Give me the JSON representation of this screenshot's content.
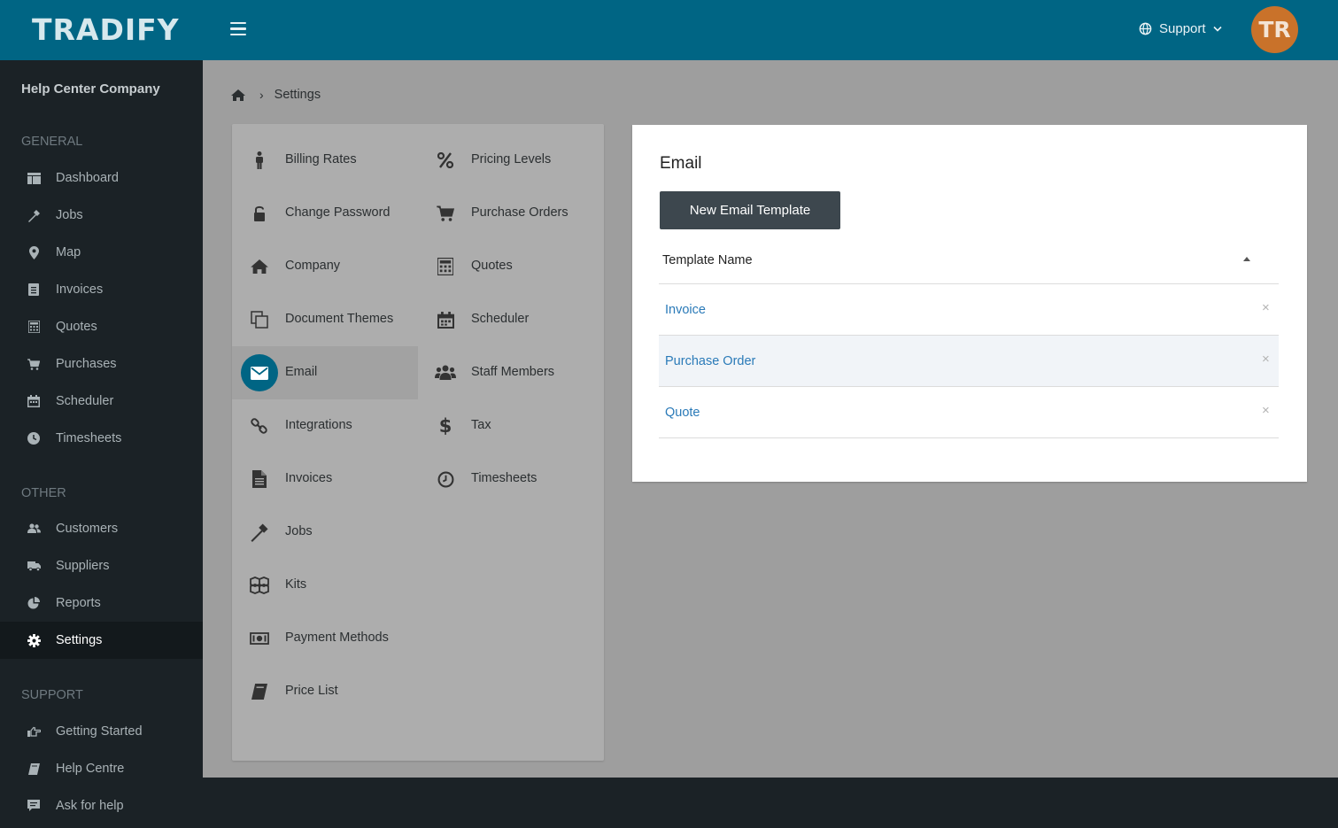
{
  "app": {
    "logo": "TRADIFY"
  },
  "header": {
    "support_label": "Support",
    "support_icon": "globe-icon",
    "avatar_initials": "TR",
    "accent": "#006584",
    "avatar_color": "#c9722a"
  },
  "sidebar": {
    "company": "Help Center Company",
    "sections": {
      "general": "GENERAL",
      "other": "OTHER",
      "support": "SUPPORT"
    },
    "general": [
      {
        "label": "Dashboard",
        "icon": "dashboard-icon"
      },
      {
        "label": "Jobs",
        "icon": "hammer-icon"
      },
      {
        "label": "Map",
        "icon": "map-pin-icon"
      },
      {
        "label": "Invoices",
        "icon": "invoice-icon"
      },
      {
        "label": "Quotes",
        "icon": "calculator-icon"
      },
      {
        "label": "Purchases",
        "icon": "cart-icon"
      },
      {
        "label": "Scheduler",
        "icon": "calendar-icon"
      },
      {
        "label": "Timesheets",
        "icon": "clock-icon"
      }
    ],
    "other": [
      {
        "label": "Customers",
        "icon": "users-icon"
      },
      {
        "label": "Suppliers",
        "icon": "truck-icon"
      },
      {
        "label": "Reports",
        "icon": "pie-chart-icon"
      },
      {
        "label": "Settings",
        "icon": "gear-icon",
        "active": true
      }
    ],
    "support": [
      {
        "label": "Getting Started",
        "icon": "hand-point-icon"
      },
      {
        "label": "Help Centre",
        "icon": "book-icon"
      },
      {
        "label": "Ask for help",
        "icon": "chat-icon"
      }
    ]
  },
  "breadcrumb": {
    "home_icon": "home-icon",
    "current": "Settings"
  },
  "settings_menu": {
    "left": [
      {
        "label": "Billing Rates",
        "icon": "person-icon"
      },
      {
        "label": "Change Password",
        "icon": "unlock-icon"
      },
      {
        "label": "Company",
        "icon": "home-icon"
      },
      {
        "label": "Document Themes",
        "icon": "copy-icon"
      },
      {
        "label": "Email",
        "icon": "envelope-icon",
        "active": true
      },
      {
        "label": "Integrations",
        "icon": "link-icon"
      },
      {
        "label": "Invoices",
        "icon": "file-icon"
      },
      {
        "label": "Jobs",
        "icon": "hammer-icon"
      },
      {
        "label": "Kits",
        "icon": "cubes-icon"
      },
      {
        "label": "Payment Methods",
        "icon": "money-icon"
      },
      {
        "label": "Price List",
        "icon": "book-icon"
      }
    ],
    "right": [
      {
        "label": "Pricing Levels",
        "icon": "percent-icon"
      },
      {
        "label": "Purchase Orders",
        "icon": "cart-icon"
      },
      {
        "label": "Quotes",
        "icon": "calculator-icon"
      },
      {
        "label": "Scheduler",
        "icon": "calendar-icon"
      },
      {
        "label": "Staff Members",
        "icon": "users-icon"
      },
      {
        "label": "Tax",
        "icon": "dollar-icon"
      },
      {
        "label": "Timesheets",
        "icon": "clock-icon"
      }
    ]
  },
  "email_panel": {
    "title": "Email",
    "new_button": "New Email Template",
    "column_header": "Template Name",
    "templates": [
      "Invoice",
      "Purchase Order",
      "Quote"
    ],
    "delete_glyph": "×"
  }
}
